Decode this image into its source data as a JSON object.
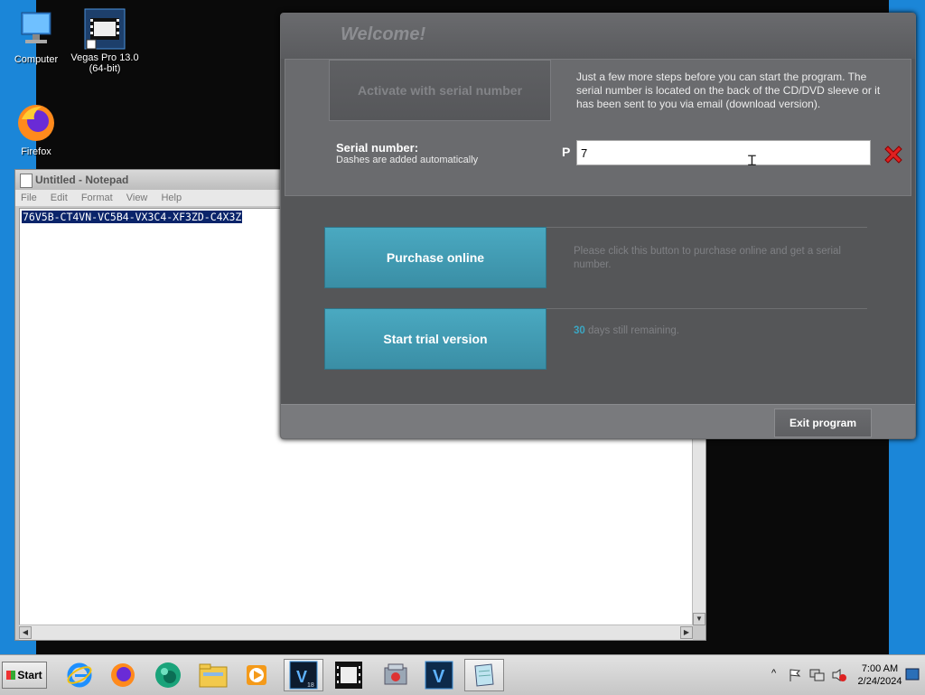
{
  "desktop": {
    "icons": [
      {
        "label": "Computer"
      },
      {
        "label": "Vegas Pro 13.0\n(64-bit)"
      },
      {
        "label": "Firefox"
      }
    ]
  },
  "notepad": {
    "title": "Untitled - Notepad",
    "menu": [
      "File",
      "Edit",
      "Format",
      "View",
      "Help"
    ],
    "selected_text": "76V5B-CT4VN-VC5B4-VX3C4-XF3ZD-C4X3Z"
  },
  "dialog": {
    "heading": "Welcome!",
    "activate_button": "Activate with serial number",
    "activate_info": "Just a few more steps before you can start the program. The serial number is located on the back of the CD/DVD sleeve or it has been sent to you via email (download version).",
    "serial_label": "Serial number:",
    "serial_hint": "Dashes are added automatically",
    "serial_prefix": "P",
    "serial_value": "7",
    "purchase_button": "Purchase online",
    "purchase_info": "Please click this button to purchase online and get a serial number.",
    "trial_button": "Start trial version",
    "trial_days": "30",
    "trial_days_suffix": " days still remaining.",
    "exit_button": "Exit program"
  },
  "taskbar": {
    "start_label": "Start",
    "apps": [
      "internet-explorer",
      "firefox",
      "edge-beta",
      "file-explorer",
      "media-player",
      "vegas-pro-18",
      "vegas-pro-13",
      "control-panel",
      "vegas-pro",
      "notepad"
    ],
    "clock_time": "7:00 AM",
    "clock_date": "2/24/2024"
  },
  "colors": {
    "dialog_bg": "#555658",
    "accent_button": "#3a8ea5",
    "days_highlight": "#3ba6c2",
    "desktop_blue": "#1b86d8"
  }
}
